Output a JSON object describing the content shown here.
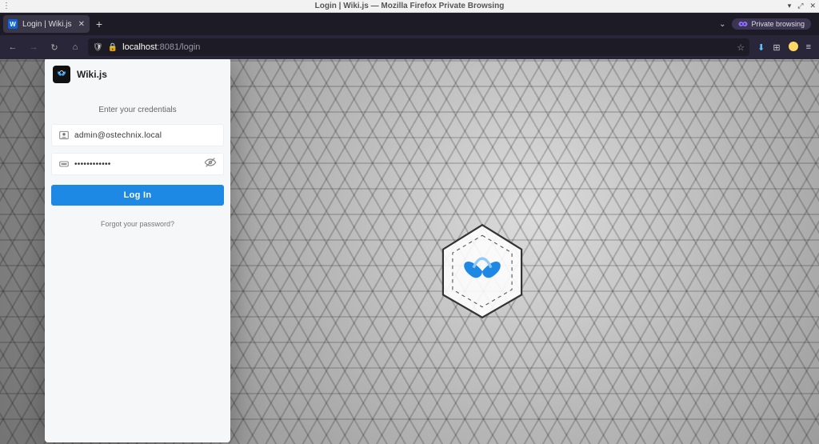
{
  "os": {
    "title": "Login | Wiki.js — Mozilla Firefox Private Browsing"
  },
  "browser": {
    "tab_label": "Login | Wiki.js",
    "private_label": "Private browsing",
    "url_host": "localhost",
    "url_port_path": ":8081/login"
  },
  "login": {
    "app_name": "Wiki.js",
    "prompt": "Enter your credentials",
    "email_value": "admin@ostechnix.local",
    "password_value": "••••••••••••",
    "button_label": "Log In",
    "forgot_label": "Forgot your password?"
  }
}
